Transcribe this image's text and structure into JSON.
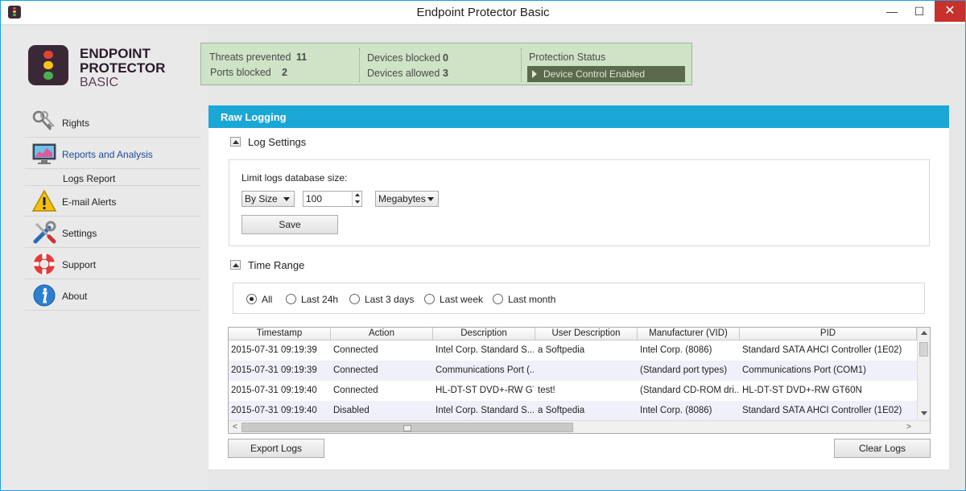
{
  "window": {
    "title": "Endpoint Protector Basic",
    "minimize": "—",
    "maximize": "☐",
    "close": "✕"
  },
  "brand": {
    "line1": "ENDPOINT",
    "line2": "PROTECTOR",
    "line3": "BASIC"
  },
  "stats": {
    "threats_label": "Threats prevented",
    "threats_value": "11",
    "ports_label": "Ports blocked",
    "ports_value": "2",
    "devices_blocked_label": "Devices blocked",
    "devices_blocked_value": "0",
    "devices_allowed_label": "Devices allowed",
    "devices_allowed_value": "3",
    "protection_label": "Protection Status",
    "protection_status": "Device Control Enabled"
  },
  "sidebar": {
    "items": [
      {
        "label": "Rights",
        "icon": "keys-icon"
      },
      {
        "label": "Reports and Analysis",
        "icon": "monitor-chart-icon"
      },
      {
        "label": "E-mail Alerts",
        "icon": "warning-icon"
      },
      {
        "label": "Settings",
        "icon": "tools-icon"
      },
      {
        "label": "Support",
        "icon": "lifebuoy-icon"
      },
      {
        "label": "About",
        "icon": "info-icon"
      }
    ],
    "subitem": "Logs Report"
  },
  "panel": {
    "title": "Raw Logging",
    "log_settings": {
      "title": "Log Settings",
      "limit_label": "Limit logs database size:",
      "mode": "By Size",
      "size_value": "100",
      "unit": "Megabytes",
      "save_label": "Save"
    },
    "time_range": {
      "title": "Time Range",
      "options": [
        "All",
        "Last 24h",
        "Last 3 days",
        "Last week",
        "Last month"
      ],
      "selected": "All"
    },
    "table": {
      "columns": [
        "Timestamp",
        "Action",
        "Description",
        "User Description",
        "Manufacturer (VID)",
        "PID"
      ],
      "rows": [
        [
          "2015-07-31 09:19:39",
          "Connected",
          "Intel Corp. Standard S...",
          "a Softpedia",
          "Intel Corp. (8086)",
          "Standard SATA AHCI Controller (1E02)"
        ],
        [
          "2015-07-31 09:19:39",
          "Connected",
          "Communications Port (...",
          "",
          "(Standard port types)",
          "Communications Port (COM1)"
        ],
        [
          "2015-07-31 09:19:40",
          "Connected",
          "HL-DT-ST DVD+-RW GT...",
          "test!",
          "(Standard CD-ROM dri...",
          "HL-DT-ST DVD+-RW GT60N"
        ],
        [
          "2015-07-31 09:19:40",
          "Disabled",
          "Intel Corp. Standard S...",
          "a Softpedia",
          "Intel Corp. (8086)",
          "Standard SATA AHCI Controller (1E02)"
        ]
      ]
    },
    "export_label": "Export Logs",
    "clear_label": "Clear Logs"
  },
  "colors": {
    "accent": "#1ba7d6",
    "stats_bg": "#cfe3c7",
    "status_pill": "#5a6a4a",
    "close_btn": "#c7302b"
  }
}
